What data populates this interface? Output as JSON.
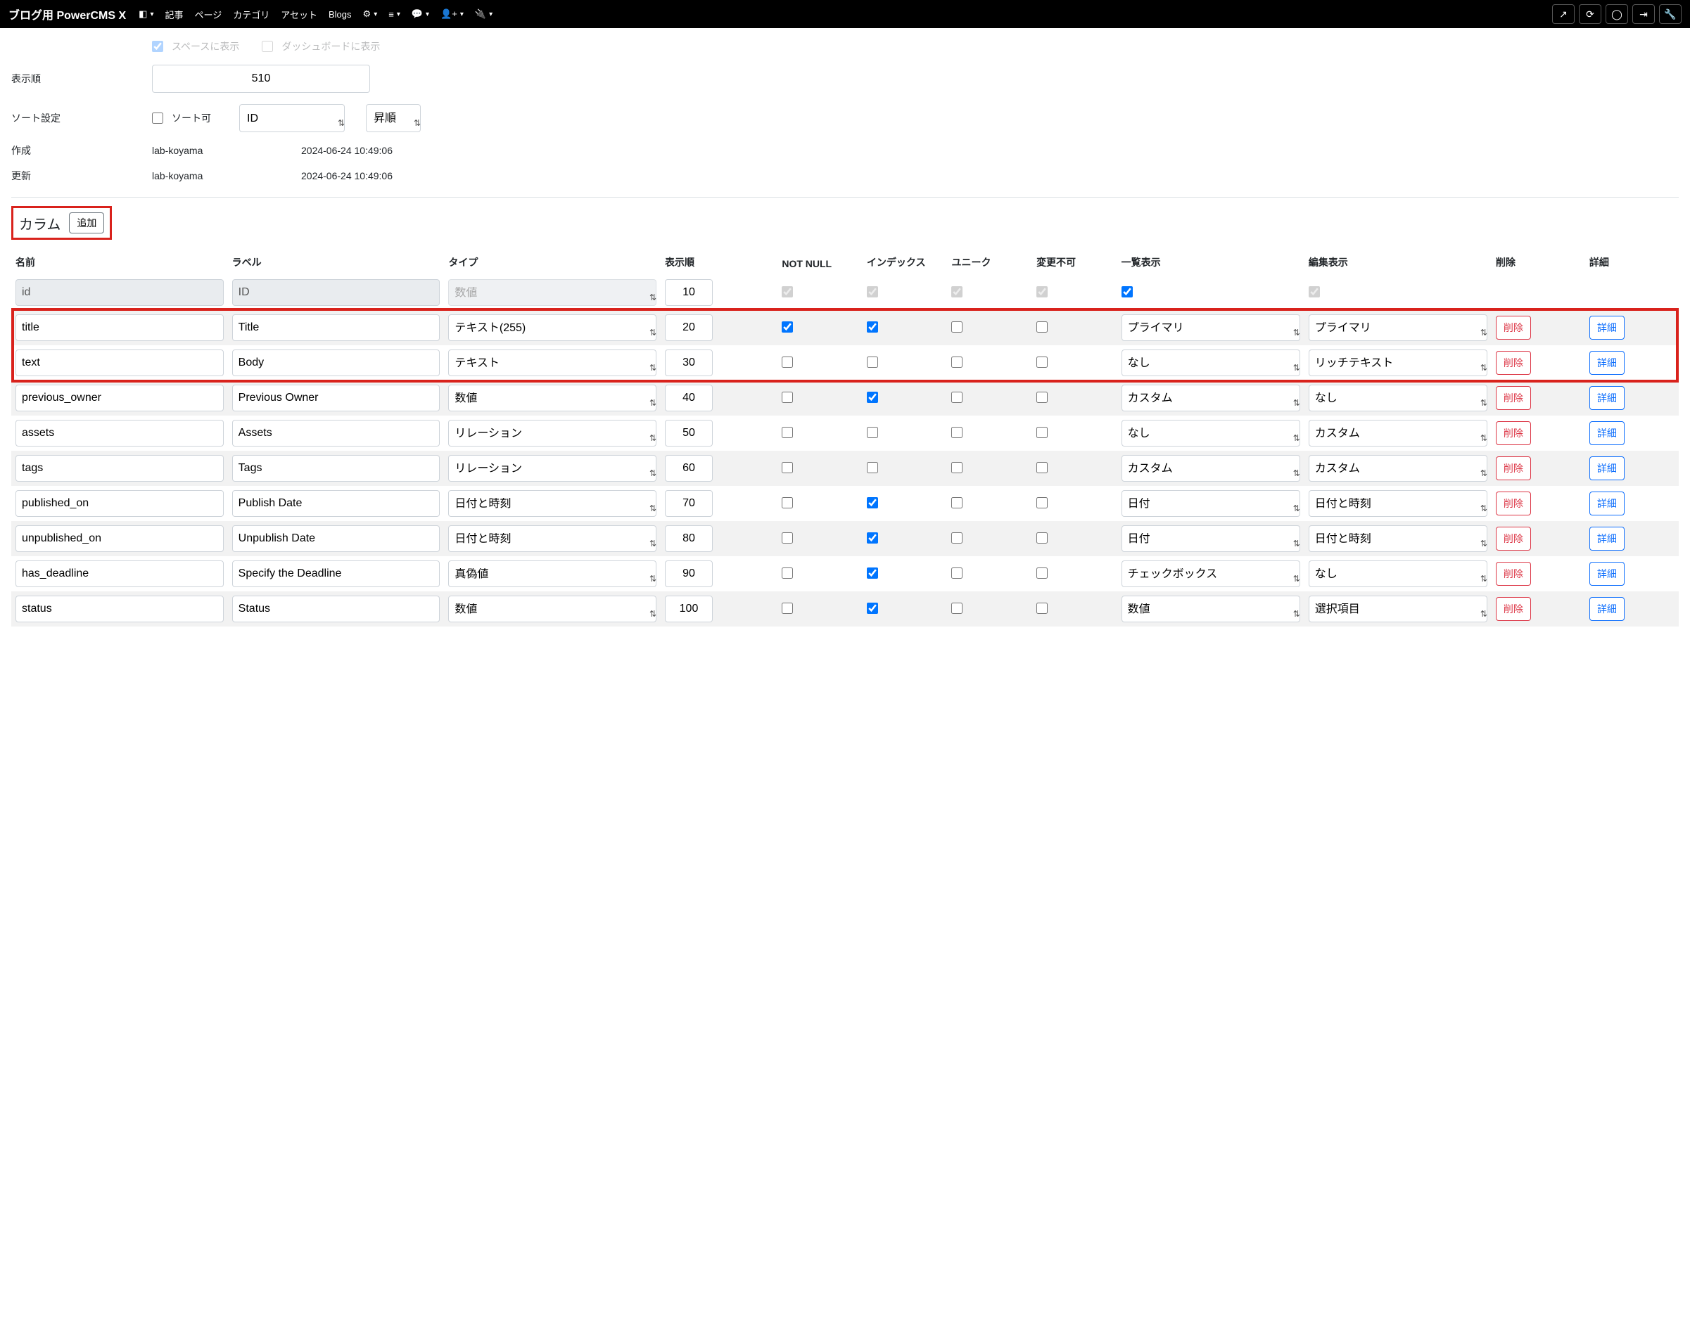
{
  "navbar": {
    "brand": "ブログ用 PowerCMS X",
    "menu": [
      "記事",
      "ページ",
      "カテゴリ",
      "アセット",
      "Blogs"
    ]
  },
  "form": {
    "order_label": "表示順",
    "order_value": "510",
    "sort_label": "ソート設定",
    "sort_checkbox_label": "ソート可",
    "sort_field": "ID",
    "sort_dir": "昇順",
    "created_label": "作成",
    "created_by": "lab-koyama",
    "created_at": "2024-06-24 10:49:06",
    "updated_label": "更新",
    "updated_by": "lab-koyama",
    "updated_at": "2024-06-24 10:49:06"
  },
  "columns": {
    "title": "カラム",
    "add_btn": "追加",
    "headers": {
      "name": "名前",
      "label": "ラベル",
      "type": "タイプ",
      "order": "表示順",
      "notnull": "NOT NULL",
      "index": "インデックス",
      "unique": "ユニーク",
      "locked": "変更不可",
      "list": "一覧表示",
      "edit": "編集表示",
      "delete": "削除",
      "detail": "詳細"
    },
    "type_options": [
      "数値",
      "テキスト(255)",
      "テキスト",
      "リレーション",
      "日付と時刻",
      "真偽値"
    ],
    "list_options": [
      "なし",
      "プライマリ",
      "カスタム",
      "日付",
      "チェックボックス",
      "数値"
    ],
    "edit_options": [
      "なし",
      "プライマリ",
      "リッチテキスト",
      "カスタム",
      "日付と時刻",
      "選択項目"
    ],
    "btn_delete": "削除",
    "btn_detail": "詳細",
    "rows": [
      {
        "name": "id",
        "label": "ID",
        "type": "数値",
        "order": "10",
        "notnull": true,
        "index": true,
        "unique": true,
        "locked": true,
        "list_chk": true,
        "list": "",
        "edit_chk": true,
        "edit": "",
        "disabled": true,
        "no_actions": true,
        "chk_disabled": true
      },
      {
        "name": "title",
        "label": "Title",
        "type": "テキスト(255)",
        "order": "20",
        "notnull": true,
        "index": true,
        "unique": false,
        "locked": false,
        "list": "プライマリ",
        "edit": "プライマリ"
      },
      {
        "name": "text",
        "label": "Body",
        "type": "テキスト",
        "order": "30",
        "notnull": false,
        "index": false,
        "unique": false,
        "locked": false,
        "list": "なし",
        "edit": "リッチテキスト"
      },
      {
        "name": "previous_owner",
        "label": "Previous Owner",
        "type": "数値",
        "order": "40",
        "notnull": false,
        "index": true,
        "unique": false,
        "locked": false,
        "list": "カスタム",
        "edit": "なし"
      },
      {
        "name": "assets",
        "label": "Assets",
        "type": "リレーション",
        "order": "50",
        "notnull": false,
        "index": false,
        "unique": false,
        "locked": false,
        "list": "なし",
        "edit": "カスタム"
      },
      {
        "name": "tags",
        "label": "Tags",
        "type": "リレーション",
        "order": "60",
        "notnull": false,
        "index": false,
        "unique": false,
        "locked": false,
        "list": "カスタム",
        "edit": "カスタム"
      },
      {
        "name": "published_on",
        "label": "Publish Date",
        "type": "日付と時刻",
        "order": "70",
        "notnull": false,
        "index": true,
        "unique": false,
        "locked": false,
        "list": "日付",
        "edit": "日付と時刻"
      },
      {
        "name": "unpublished_on",
        "label": "Unpublish Date",
        "type": "日付と時刻",
        "order": "80",
        "notnull": false,
        "index": true,
        "unique": false,
        "locked": false,
        "list": "日付",
        "edit": "日付と時刻"
      },
      {
        "name": "has_deadline",
        "label": "Specify the Deadline",
        "type": "真偽値",
        "order": "90",
        "notnull": false,
        "index": true,
        "unique": false,
        "locked": false,
        "list": "チェックボックス",
        "edit": "なし"
      },
      {
        "name": "status",
        "label": "Status",
        "type": "数値",
        "order": "100",
        "notnull": false,
        "index": true,
        "unique": false,
        "locked": false,
        "list": "数値",
        "edit": "選択項目"
      }
    ]
  }
}
